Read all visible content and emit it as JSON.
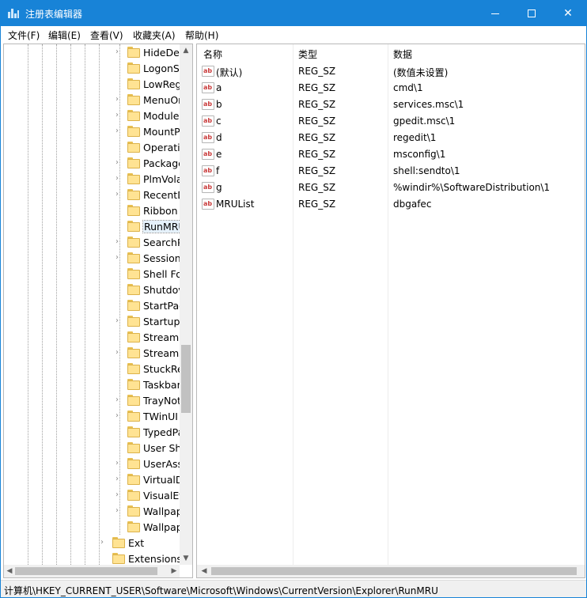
{
  "window": {
    "title": "注册表编辑器"
  },
  "menu": [
    "文件(F)",
    "编辑(E)",
    "查看(V)",
    "收藏夹(A)",
    "帮助(H)"
  ],
  "tree": {
    "items": [
      {
        "label": "HideDes",
        "expandable": true
      },
      {
        "label": "LogonSt",
        "expandable": false
      },
      {
        "label": "LowReg",
        "expandable": false
      },
      {
        "label": "MenuOr",
        "expandable": true
      },
      {
        "label": "Module",
        "expandable": true
      },
      {
        "label": "MountP",
        "expandable": true
      },
      {
        "label": "Operati",
        "expandable": false
      },
      {
        "label": "Package",
        "expandable": true
      },
      {
        "label": "PlmVola",
        "expandable": true
      },
      {
        "label": "RecentD",
        "expandable": true
      },
      {
        "label": "Ribbon",
        "expandable": false
      },
      {
        "label": "RunMRU",
        "expandable": false,
        "selected": true
      },
      {
        "label": "SearchP",
        "expandable": true
      },
      {
        "label": "Session",
        "expandable": true
      },
      {
        "label": "Shell Fo",
        "expandable": false
      },
      {
        "label": "Shutdov",
        "expandable": false
      },
      {
        "label": "StartPag",
        "expandable": false
      },
      {
        "label": "StartupA",
        "expandable": true
      },
      {
        "label": "StreamM",
        "expandable": false
      },
      {
        "label": "Streams",
        "expandable": true
      },
      {
        "label": "StuckRe",
        "expandable": false
      },
      {
        "label": "Taskbar",
        "expandable": false
      },
      {
        "label": "TrayNot",
        "expandable": true
      },
      {
        "label": "TWinUI",
        "expandable": true
      },
      {
        "label": "TypedPa",
        "expandable": false
      },
      {
        "label": "User Sh",
        "expandable": false
      },
      {
        "label": "UserAss",
        "expandable": true
      },
      {
        "label": "VirtualD",
        "expandable": true
      },
      {
        "label": "VisualEf",
        "expandable": true
      },
      {
        "label": "Wallpap",
        "expandable": true
      },
      {
        "label": "Wallpap",
        "expandable": false
      }
    ],
    "parent_items": [
      {
        "label": "Ext",
        "expandable": true
      },
      {
        "label": "Extensions",
        "expandable": false
      }
    ]
  },
  "list": {
    "columns": [
      "名称",
      "类型",
      "数据"
    ],
    "rows": [
      {
        "name": "(默认)",
        "type": "REG_SZ",
        "data": "(数值未设置)"
      },
      {
        "name": "a",
        "type": "REG_SZ",
        "data": "cmd\\1"
      },
      {
        "name": "b",
        "type": "REG_SZ",
        "data": "services.msc\\1"
      },
      {
        "name": "c",
        "type": "REG_SZ",
        "data": "gpedit.msc\\1"
      },
      {
        "name": "d",
        "type": "REG_SZ",
        "data": "regedit\\1"
      },
      {
        "name": "e",
        "type": "REG_SZ",
        "data": "msconfig\\1"
      },
      {
        "name": "f",
        "type": "REG_SZ",
        "data": "shell:sendto\\1"
      },
      {
        "name": "g",
        "type": "REG_SZ",
        "data": "%windir%\\SoftwareDistribution\\1"
      },
      {
        "name": "MRUList",
        "type": "REG_SZ",
        "data": "dbgafec"
      }
    ],
    "value_icon_text": "ab"
  },
  "status": {
    "path": "计算机\\HKEY_CURRENT_USER\\Software\\Microsoft\\Windows\\CurrentVersion\\Explorer\\RunMRU"
  },
  "colors": {
    "titlebar": "#1883d7",
    "folder": "#ffe393",
    "selection": "#e5f1fb"
  }
}
